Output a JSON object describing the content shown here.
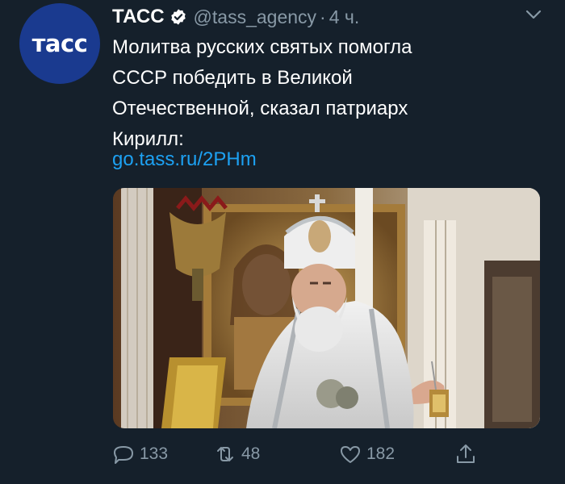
{
  "tweet": {
    "avatar_text": "тасс",
    "display_name": "ТАСС",
    "handle": "@tass_agency",
    "separator": "·",
    "time": "4 ч.",
    "text_lines": [
      "Молитва русских святых помогла",
      "СССР победить в Великой",
      "Отечественной, сказал патриарх",
      "Кирилл:"
    ],
    "link": "go.tass.ru/2PHm",
    "actions": {
      "replies": "133",
      "retweets": "48",
      "likes": "182"
    }
  },
  "colors": {
    "background": "#15202b",
    "secondary_text": "#8899a6",
    "link": "#1da1f2",
    "verified": "#ffffff",
    "avatar_bg": "#1a3a8f"
  },
  "icons": [
    "verified-badge-icon",
    "chevron-down-icon",
    "reply-icon",
    "retweet-icon",
    "like-icon",
    "share-icon"
  ]
}
